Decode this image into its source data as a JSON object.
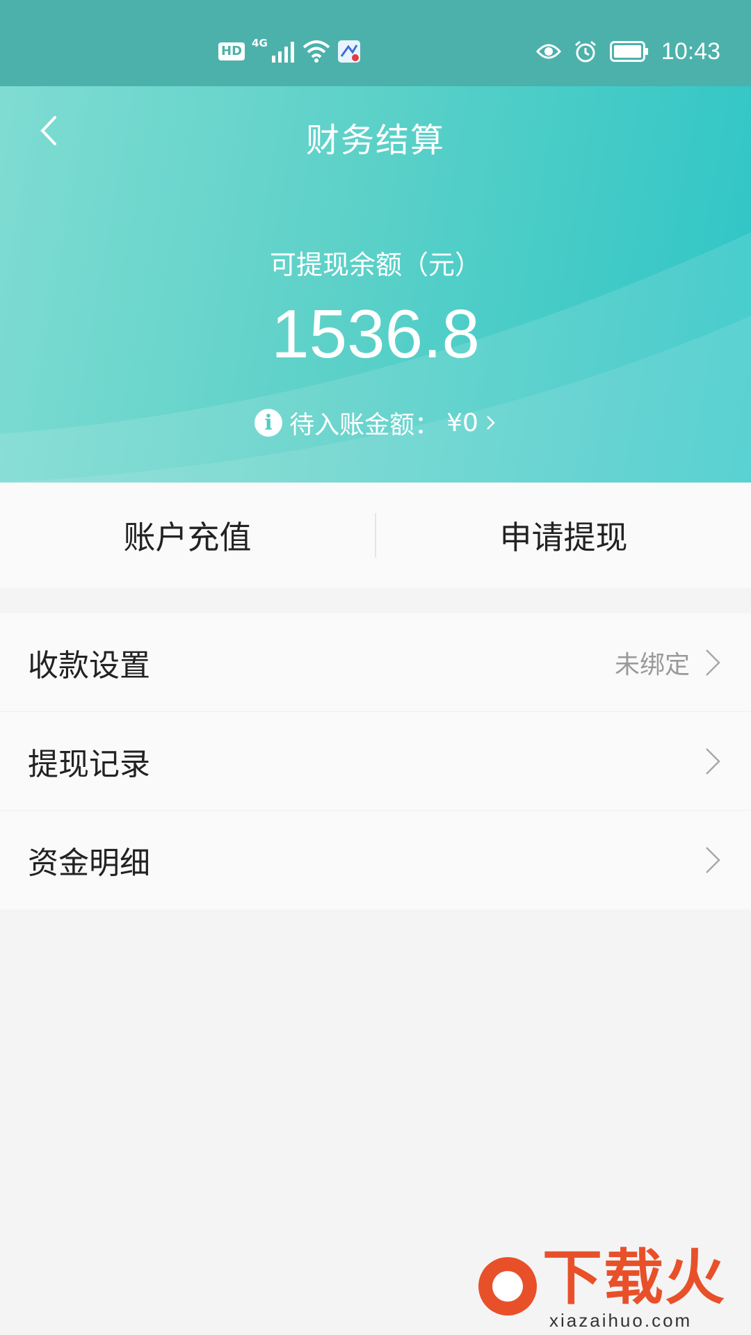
{
  "status_bar": {
    "hd": "HD",
    "network": "4G",
    "time": "10:43"
  },
  "header": {
    "title": "财务结算",
    "balance_label": "可提现余额（元）",
    "balance_value": "1536.8",
    "pending_label": "待入账金额：",
    "pending_value": "¥0"
  },
  "actions": {
    "recharge": "账户充值",
    "withdraw": "申请提现"
  },
  "menu": [
    {
      "label": "收款设置",
      "value": "未绑定"
    },
    {
      "label": "提现记录",
      "value": ""
    },
    {
      "label": "资金明细",
      "value": ""
    }
  ],
  "watermark": {
    "text": "下载火",
    "url": "xiazaihuo.com"
  },
  "colors": {
    "status_bar": "#4cb1ab",
    "header_start": "#7fdcd3",
    "header_end": "#2ec5c6",
    "watermark": "#e8502a"
  }
}
